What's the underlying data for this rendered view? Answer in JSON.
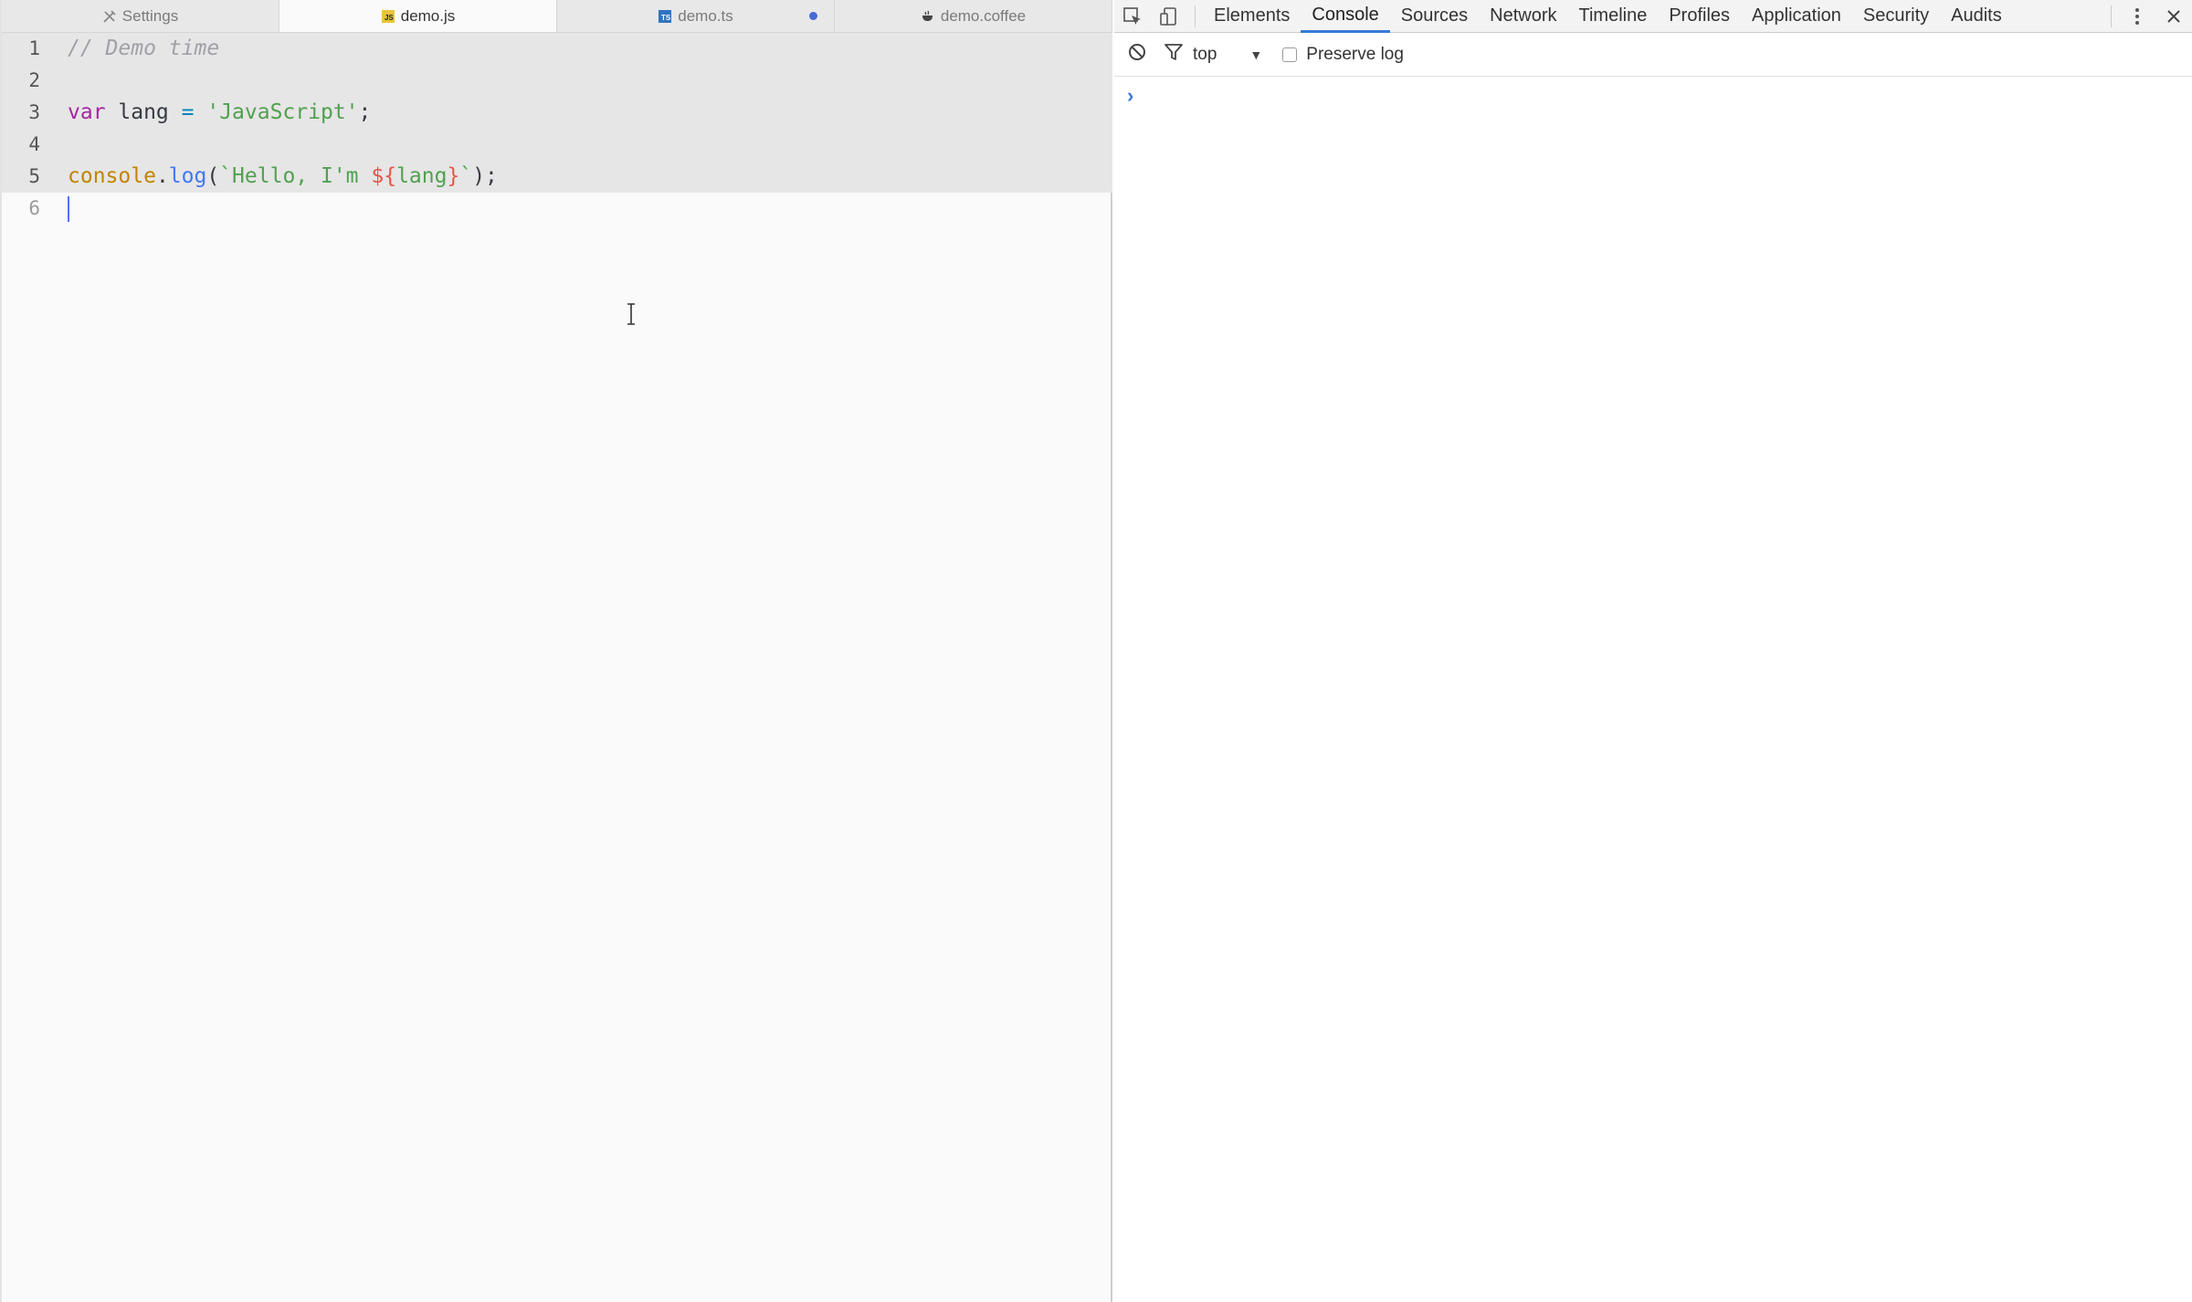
{
  "editor": {
    "tabs": [
      {
        "label": "Settings",
        "icon": "tools-icon",
        "active": false,
        "modified": false
      },
      {
        "label": "demo.js",
        "icon": "js-file-icon",
        "icon_text": "JS",
        "active": true,
        "modified": false
      },
      {
        "label": "demo.ts",
        "icon": "ts-file-icon",
        "icon_text": "TS",
        "active": false,
        "modified": true
      },
      {
        "label": "demo.coffee",
        "icon": "coffee-file-icon",
        "active": false,
        "modified": false
      }
    ],
    "lines": [
      {
        "num": "1",
        "text": "// Demo time"
      },
      {
        "num": "2",
        "text": ""
      },
      {
        "num": "3",
        "text": "var lang = 'JavaScript';"
      },
      {
        "num": "4",
        "text": ""
      },
      {
        "num": "5",
        "text": "console.log(`Hello, I'm ${lang}`);"
      },
      {
        "num": "6",
        "text": ""
      }
    ],
    "tokens": {
      "l1_comment": "// Demo time",
      "l3_kw": "var",
      "l3_name": " lang ",
      "l3_op": "=",
      "l3_str": " 'JavaScript'",
      "l3_end": ";",
      "l5_obj": "console",
      "l5_dot": ".",
      "l5_fn": "log",
      "l5_paren": "(",
      "l5_str1": "`Hello, I'm ",
      "l5_tpl_open": "${",
      "l5_var": "lang",
      "l5_tpl_close": "}",
      "l5_str2": "`",
      "l5_end": ");"
    },
    "colors": {
      "accent": "#526fff",
      "modified_dot": "#4a68d8"
    }
  },
  "devtools": {
    "tabs": [
      {
        "label": "Elements",
        "active": false
      },
      {
        "label": "Console",
        "active": true
      },
      {
        "label": "Sources",
        "active": false
      },
      {
        "label": "Network",
        "active": false
      },
      {
        "label": "Timeline",
        "active": false
      },
      {
        "label": "Profiles",
        "active": false
      },
      {
        "label": "Application",
        "active": false
      },
      {
        "label": "Security",
        "active": false
      },
      {
        "label": "Audits",
        "active": false
      }
    ],
    "toolbar_icons": [
      "inspect-element-icon",
      "device-mode-icon",
      "more-options-icon",
      "close-icon"
    ],
    "console": {
      "context": "top",
      "preserve_log_label": "Preserve log",
      "preserve_log_checked": false,
      "prompt_symbol": "›"
    },
    "colors": {
      "active_tab": "#3879d9"
    }
  }
}
